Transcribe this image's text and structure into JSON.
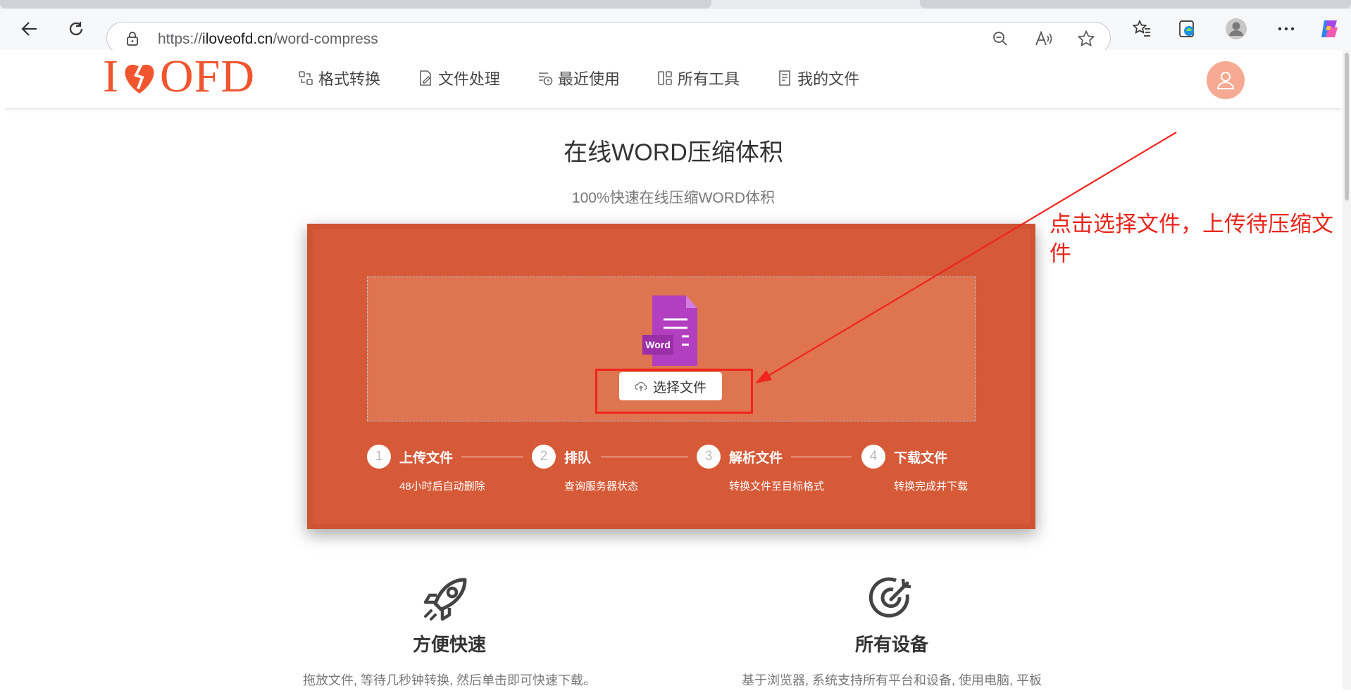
{
  "browser": {
    "url_prefix": "https://",
    "url_host": "iloveofd.cn",
    "url_path": "/word-compress"
  },
  "site": {
    "logo_left": "I",
    "logo_right": "OFD",
    "nav": [
      {
        "label": "格式转换",
        "icon": "convert-icon"
      },
      {
        "label": "文件处理",
        "icon": "file-edit-icon"
      },
      {
        "label": "最近使用",
        "icon": "recent-icon"
      },
      {
        "label": "所有工具",
        "icon": "grid-icon"
      },
      {
        "label": "我的文件",
        "icon": "my-files-icon"
      }
    ]
  },
  "main": {
    "title": "在线WORD压缩体积",
    "subtitle": "100%快速在线压缩WORD体积",
    "file_badge": "Word",
    "select_button": "选择文件",
    "steps": [
      {
        "num": "1",
        "title": "上传文件",
        "desc": "48小时后自动删除"
      },
      {
        "num": "2",
        "title": "排队",
        "desc": "查询服务器状态"
      },
      {
        "num": "3",
        "title": "解析文件",
        "desc": "转换文件至目标格式"
      },
      {
        "num": "4",
        "title": "下载文件",
        "desc": "转换完成并下载"
      }
    ]
  },
  "features": [
    {
      "title": "方便快速",
      "desc": "拖放文件, 等待几秒钟转换, 然后单击即可快速下载。",
      "icon": "rocket-icon"
    },
    {
      "title": "所有设备",
      "desc": "基于浏览器, 系统支持所有平台和设备, 使用电脑, 平板",
      "icon": "target-icon"
    }
  ],
  "annotation": {
    "text": "点击选择文件，上传待压缩文件",
    "color": "#e8261c"
  },
  "colors": {
    "brand": "#f0552e",
    "card": "#d65a38",
    "dropzone": "#de7550",
    "word_purple": "#b23fbf"
  }
}
